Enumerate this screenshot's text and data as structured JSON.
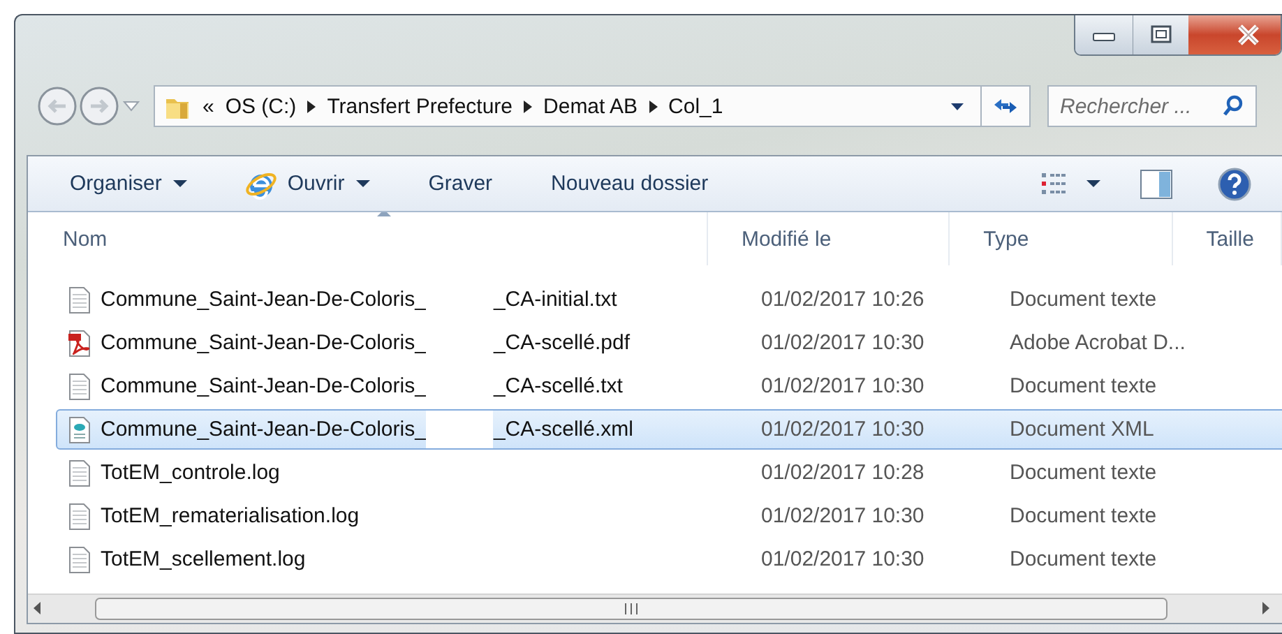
{
  "navigation": {
    "overflow": "«",
    "breadcrumb": [
      "OS (C:)",
      "Transfert Prefecture",
      "Demat AB",
      "Col_1"
    ]
  },
  "search": {
    "placeholder": "Rechercher ..."
  },
  "toolbar": {
    "items": [
      {
        "label": "Organiser",
        "kind": "menu"
      },
      {
        "label": "Ouvrir",
        "kind": "open-with"
      },
      {
        "label": "Graver",
        "kind": "plain"
      },
      {
        "label": "Nouveau dossier",
        "kind": "plain"
      }
    ]
  },
  "columns": [
    {
      "label": "Nom",
      "sorted": true
    },
    {
      "label": "Modifié le",
      "sorted": false
    },
    {
      "label": "Type",
      "sorted": false
    },
    {
      "label": "Taille",
      "sorted": false
    }
  ],
  "files": [
    {
      "name_parts": [
        "Commune_Saint-Jean-De-Coloris_",
        "_CA-initial.txt"
      ],
      "kind": "text",
      "modified": "01/02/2017 10:26",
      "type": "Document texte",
      "selected": false
    },
    {
      "name_parts": [
        "Commune_Saint-Jean-De-Coloris_",
        "_CA-scellé.pdf"
      ],
      "kind": "pdf",
      "modified": "01/02/2017 10:30",
      "type": "Adobe Acrobat D...",
      "selected": false
    },
    {
      "name_parts": [
        "Commune_Saint-Jean-De-Coloris_",
        "_CA-scellé.txt"
      ],
      "kind": "text",
      "modified": "01/02/2017 10:30",
      "type": "Document texte",
      "selected": false
    },
    {
      "name_parts": [
        "Commune_Saint-Jean-De-Coloris_",
        "_CA-scellé.xml"
      ],
      "kind": "xml",
      "modified": "01/02/2017 10:30",
      "type": "Document XML",
      "selected": true
    },
    {
      "name_parts": [
        "TotEM_controle.log"
      ],
      "kind": "text",
      "modified": "01/02/2017 10:28",
      "type": "Document texte",
      "selected": false
    },
    {
      "name_parts": [
        "TotEM_rematerialisation.log"
      ],
      "kind": "text",
      "modified": "01/02/2017 10:30",
      "type": "Document texte",
      "selected": false
    },
    {
      "name_parts": [
        "TotEM_scellement.log"
      ],
      "kind": "text",
      "modified": "01/02/2017 10:30",
      "type": "Document texte",
      "selected": false
    }
  ]
}
